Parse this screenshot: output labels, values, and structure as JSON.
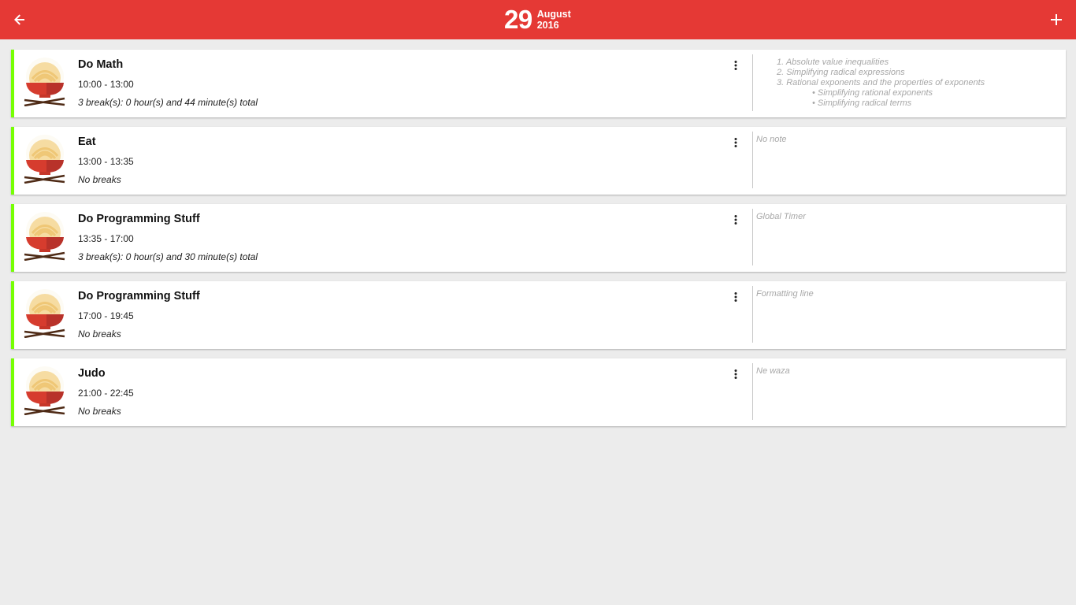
{
  "header": {
    "day": "29",
    "month": "August",
    "year": "2016",
    "back_icon": "arrow-left-icon",
    "add_icon": "plus-icon",
    "accent_color": "#e53935"
  },
  "cards": [
    {
      "title": "Do Math",
      "time": "10:00 - 13:00",
      "breaks": "3 break(s): 0 hour(s) and 44 minute(s) total",
      "note_list": [
        "1. Absolute value inequalities",
        "2. Simplifying radical expressions",
        "3. Rational exponents and the properties of exponents"
      ],
      "note_sublist": [
        "• Simplifying rational exponents",
        "• Simplifying radical terms"
      ]
    },
    {
      "title": "Eat",
      "time": "13:00 - 13:35",
      "breaks": "No breaks",
      "note": "No note"
    },
    {
      "title": "Do Programming Stuff",
      "time": "13:35 - 17:00",
      "breaks": "3 break(s): 0 hour(s) and 30 minute(s) total",
      "note": "Global Timer"
    },
    {
      "title": "Do Programming Stuff",
      "time": "17:00 - 19:45",
      "breaks": "No breaks",
      "note": "Formatting line"
    },
    {
      "title": "Judo",
      "time": "21:00 - 22:45",
      "breaks": "No breaks",
      "note": "Ne waza"
    }
  ],
  "card_accent_color": "#76ff03",
  "card_icon": "noodle-bowl-icon",
  "menu_icon": "more-vertical-icon"
}
